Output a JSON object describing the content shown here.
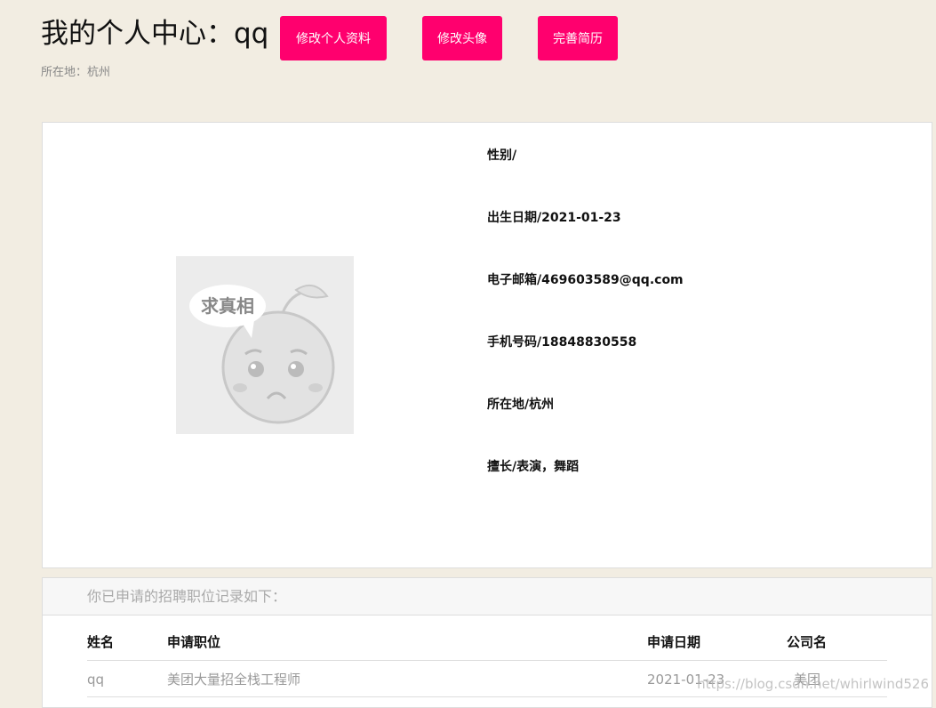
{
  "header": {
    "title": "我的个人中心：qq",
    "location": "所在地：杭州"
  },
  "buttons": {
    "edit_profile": "修改个人资料",
    "edit_avatar": "修改头像",
    "complete_resume": "完善简历"
  },
  "avatar": {
    "bubble_text": "求真相"
  },
  "profile": {
    "gender": "性别/",
    "birthdate": "出生日期/2021-01-23",
    "email": "电子邮箱/469603589@qq.com",
    "phone": "手机号码/18848830558",
    "location": "所在地/杭州",
    "skills": "擅长/表演，舞蹈"
  },
  "applications": {
    "heading": "你已申请的招聘职位记录如下：",
    "columns": [
      "姓名",
      "申请职位",
      "申请日期",
      "公司名"
    ],
    "rows": [
      [
        "qq",
        "美团大量招全栈工程师",
        "2021-01-23",
        "美团"
      ]
    ]
  },
  "watermark": "https://blog.csdn.net/whirlwind526"
}
